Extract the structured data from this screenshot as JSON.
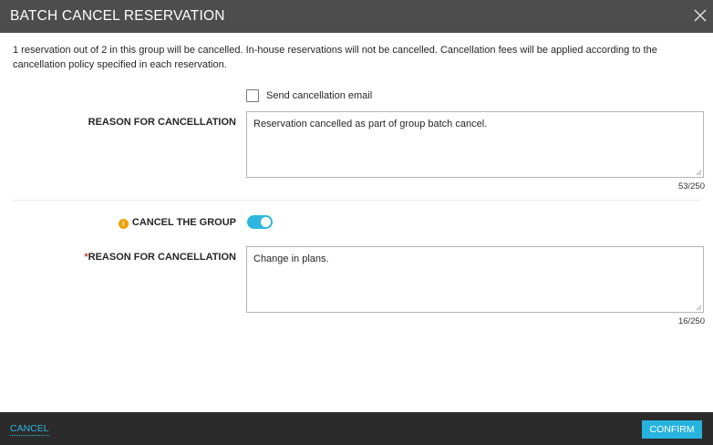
{
  "dialog": {
    "title": "BATCH CANCEL RESERVATION",
    "intro": "1 reservation out of 2 in this group will be cancelled. In-house reservations will not be cancelled. Cancellation fees will be applied according to the cancellation policy specified in each reservation.",
    "send_email": {
      "label": "Send cancellation email",
      "checked": false
    },
    "reservation_reason": {
      "label": "REASON FOR CANCELLATION",
      "value": "Reservation cancelled as part of group batch cancel.",
      "counter": "53/250"
    },
    "cancel_group": {
      "label": "CANCEL THE GROUP",
      "enabled": true,
      "info_icon": "info-icon"
    },
    "group_reason": {
      "required_mark": "*",
      "label": "REASON FOR CANCELLATION",
      "value": "Change in plans.",
      "counter": "16/250"
    }
  },
  "footer": {
    "cancel_label": "CANCEL",
    "confirm_label": "CONFIRM"
  },
  "colors": {
    "header": "#4d4d4d",
    "footer": "#2b2b2b",
    "accent": "#2db7e0",
    "info": "#f2a000",
    "required": "#d83a2e"
  }
}
